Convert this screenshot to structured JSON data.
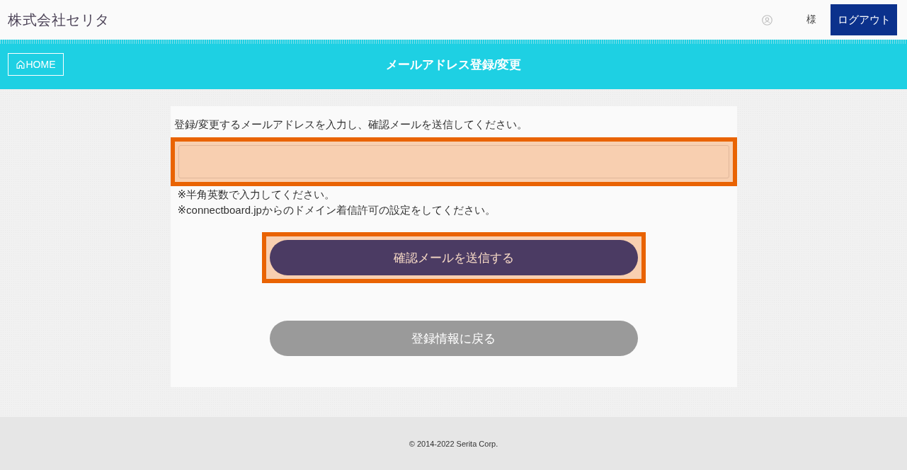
{
  "header": {
    "company_name": "株式会社セリタ",
    "user_suffix": "様",
    "logout_button": "ログアウト"
  },
  "title_bar": {
    "home_button": "HOME",
    "title": "メールアドレス登録/変更"
  },
  "form": {
    "instruction": "登録/変更するメールアドレスを入力し、確認メールを送信してください。",
    "email_field": {
      "highlighted": true
    },
    "notes": [
      "※半角英数で入力してください。",
      "※connectboard.jpからのドメイン着信許可の設定をしてください。"
    ],
    "send_button": {
      "label": "確認メールを送信する",
      "highlighted": true
    },
    "back_button": {
      "label": "登録情報に戻る"
    }
  },
  "footer": {
    "copyright": "© 2014-2022 Serita Corp."
  }
}
